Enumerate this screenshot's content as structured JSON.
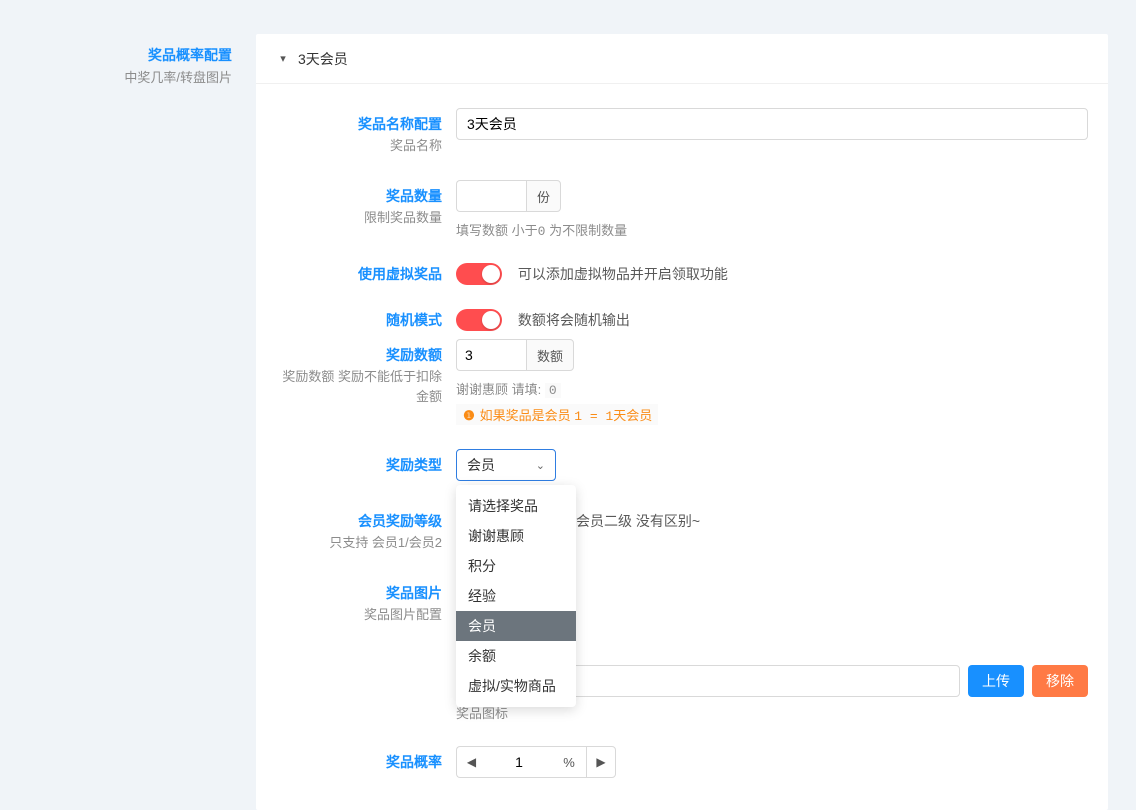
{
  "sidebar": {
    "title": "奖品概率配置",
    "subtitle": "中奖几率/转盘图片"
  },
  "collapse": {
    "title": "3天会员"
  },
  "fields": {
    "name": {
      "label": "奖品名称配置",
      "sublabel": "奖品名称",
      "value": "3天会员"
    },
    "quantity": {
      "label": "奖品数量",
      "sublabel": "限制奖品数量",
      "unit": "份",
      "help_prefix": "填写数额",
      "help_mid": "小于0",
      "help_suffix": "为不限制数量"
    },
    "virtual": {
      "label": "使用虚拟奖品",
      "desc": "可以添加虚拟物品并开启领取功能"
    },
    "random": {
      "label": "随机模式",
      "desc": "数额将会随机输出"
    },
    "amount": {
      "label": "奖励数额",
      "sublabel": "奖励数额 奖励不能低于扣除金额",
      "value": "3",
      "unit": "数额",
      "tip_prefix": "谢谢惠顾 请填:",
      "tip_code": "0",
      "warn_text": "如果奖品是会员",
      "warn_code": "1 = 1天会员"
    },
    "type": {
      "label": "奖励类型",
      "selected": "会员",
      "options": [
        "请选择奖品",
        "谢谢惠顾",
        "积分",
        "经验",
        "会员",
        "余额",
        "虚拟/实物商品"
      ]
    },
    "level": {
      "label": "会员奖励等级",
      "sublabel": "只支持 会员1/会员2",
      "note_suffix": "会员二级 没有区别~"
    },
    "image": {
      "label": "奖品图片",
      "sublabel": "奖品图片配置",
      "path": "/imc/VIP/vip.gif",
      "upload": "上传",
      "remove": "移除",
      "caption": "奖品图标"
    },
    "probability": {
      "label": "奖品概率",
      "value": "1",
      "unit": "%"
    }
  }
}
